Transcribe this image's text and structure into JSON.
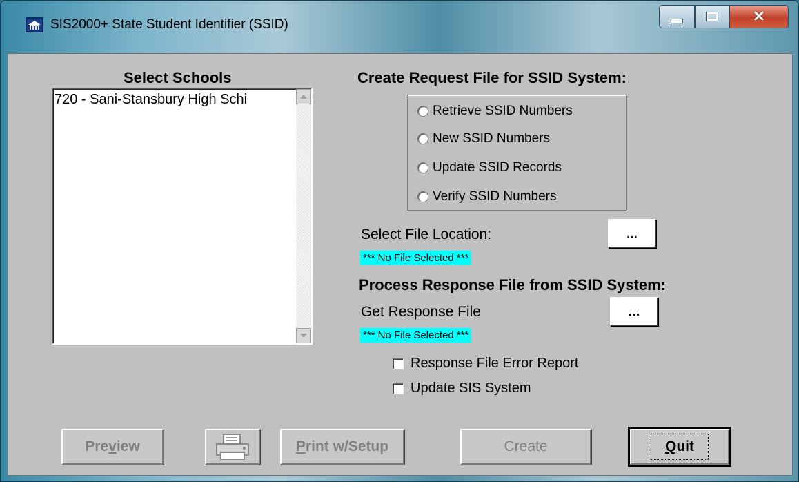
{
  "window": {
    "title": "SIS2000+ State Student Identifier (SSID)",
    "icon": "school-building-icon"
  },
  "schools": {
    "heading": "Select Schools",
    "items": [
      "720 - Sani-Stansbury High Schi"
    ]
  },
  "request": {
    "heading": "Create Request File for SSID System:",
    "options": [
      "Retrieve SSID Numbers",
      "New SSID Numbers",
      "Update SSID Records",
      "Verify SSID Numbers"
    ],
    "file_location_label": "Select File Location:",
    "browse_label": "...",
    "status": "*** No File Selected ***"
  },
  "response": {
    "heading": "Process Response File from SSID System:",
    "get_file_label": "Get Response File",
    "browse_label": "...",
    "status": "*** No File Selected ***",
    "checkboxes": [
      "Response File Error Report",
      "Update SIS System"
    ]
  },
  "buttons": {
    "preview_pre": "Pre",
    "preview_u": "v",
    "preview_post": "iew",
    "print_u": "P",
    "print_post": "rint w/Setup",
    "create": "Create",
    "quit_u": "Q",
    "quit_post": "uit",
    "printer_icon": "printer-icon"
  },
  "colors": {
    "status_highlight": "#00ffff",
    "dialog_bg": "#c0c0c0"
  }
}
